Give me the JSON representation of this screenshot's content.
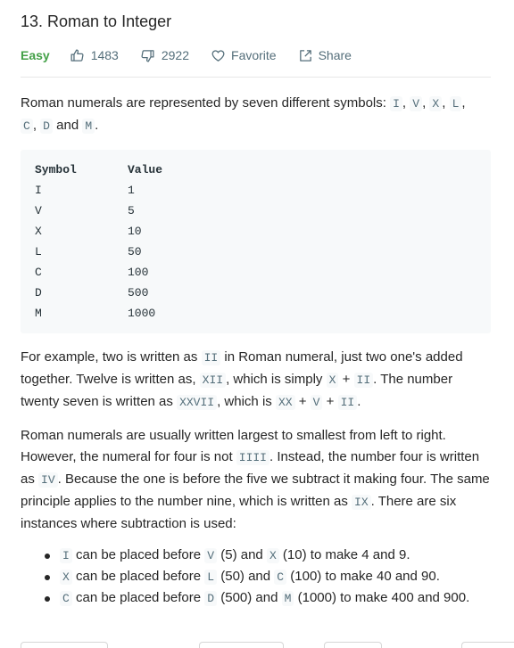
{
  "problem": {
    "title": "13. Roman to Integer",
    "difficulty": "Easy",
    "likes": "1483",
    "dislikes": "2922",
    "favorite_label": "Favorite",
    "share_label": "Share"
  },
  "description": {
    "p1": {
      "t1": "Roman numerals are represented by seven different symbols: ",
      "codes": [
        "I",
        "V",
        "X",
        "L",
        "C",
        "D",
        "M"
      ],
      "and": " and ",
      "end": "."
    },
    "table": {
      "headers": [
        "Symbol",
        "Value"
      ],
      "rows": [
        [
          "I",
          "1"
        ],
        [
          "V",
          "5"
        ],
        [
          "X",
          "10"
        ],
        [
          "L",
          "50"
        ],
        [
          "C",
          "100"
        ],
        [
          "D",
          "500"
        ],
        [
          "M",
          "1000"
        ]
      ]
    },
    "p2": {
      "t1": "For example, two is written as ",
      "c1": "II",
      "t2": " in Roman numeral, just two one's added together. Twelve is written as, ",
      "c2": "XII",
      "t3": ", which is simply ",
      "c3": "X",
      "plus": " + ",
      "c4": "II",
      "t4": ". The number twenty seven is written as ",
      "c5": "XXVII",
      "t5": ", which is ",
      "c6": "XX",
      "c7": "V",
      "c8": "II",
      "end": "."
    },
    "p3": {
      "t1": "Roman numerals are usually written largest to smallest from left to right. However, the numeral for four is not ",
      "c1": "IIII",
      "t2": ". Instead, the number four is written as ",
      "c2": "IV",
      "t3": ". Because the one is before the five we subtract it making four. The same principle applies to the number nine, which is written as ",
      "c3": "IX",
      "t4": ". There are six instances where subtraction is used:"
    },
    "bullets": [
      {
        "a": "I",
        "t1": " can be placed before ",
        "b": "V",
        "t2": " (5) and ",
        "c": "X",
        "t3": " (10) to make 4 and 9."
      },
      {
        "a": "X",
        "t1": " can be placed before ",
        "b": "L",
        "t2": " (50) and ",
        "c": "C",
        "t3": " (100) to make 40 and 90."
      },
      {
        "a": "C",
        "t1": " can be placed before ",
        "b": "D",
        "t2": " (500) and ",
        "c": "M",
        "t3": " (1000) to make 400 and 900."
      }
    ]
  },
  "colors": {
    "easy": "#43a047",
    "meta_text": "#546e7a",
    "code_bg": "#f7f9fa"
  }
}
